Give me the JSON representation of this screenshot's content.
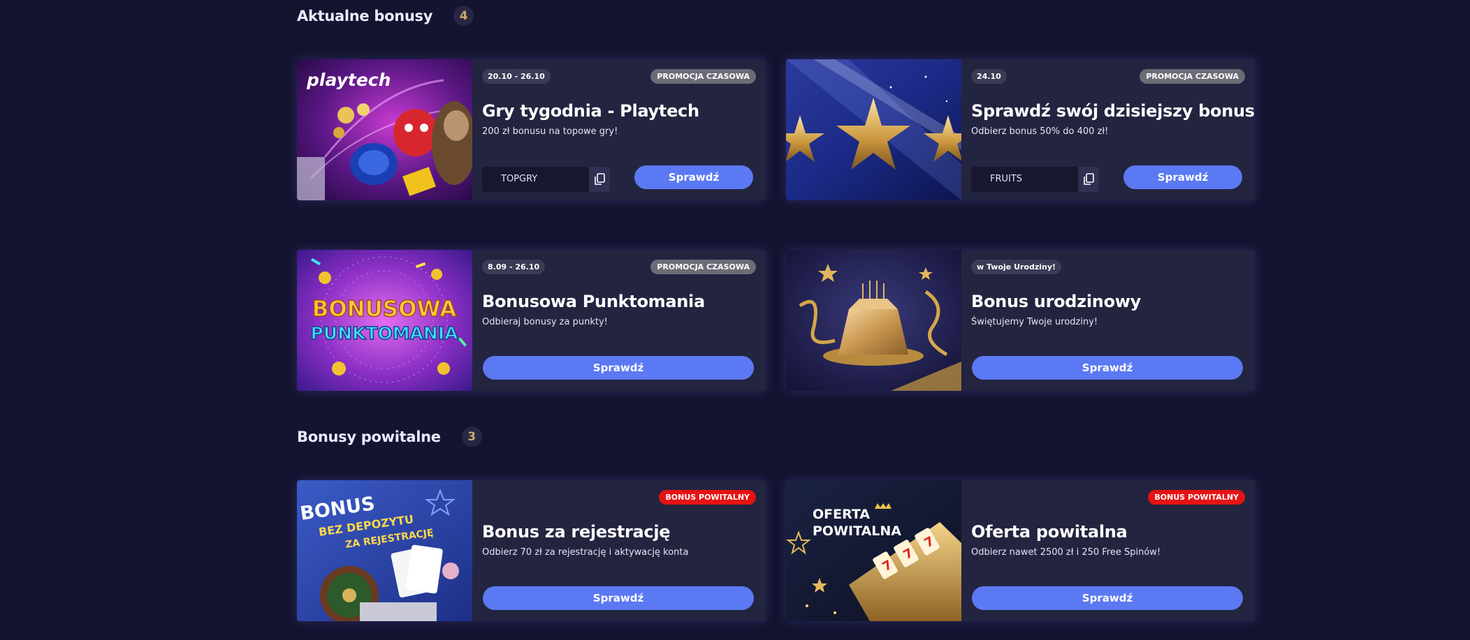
{
  "sections": {
    "current": {
      "title": "Aktualne bonusy",
      "count": "4"
    },
    "welcome": {
      "title": "Bonusy powitalne",
      "count": "3"
    }
  },
  "cards": [
    {
      "date": "20.10 - 26.10",
      "badge": "PROMOCJA CZASOWA",
      "title": "Gry tygodnia - Playtech",
      "desc": "200 zł bonusu na topowe gry!",
      "code": "TOPGRY",
      "button": "Sprawdź",
      "image_text": "playtech"
    },
    {
      "date": "24.10",
      "badge": "PROMOCJA CZASOWA",
      "title": "Sprawdź swój dzisiejszy bonus",
      "desc": "Odbierz bonus 50% do 400 zł!",
      "code": "FRUITS",
      "button": "Sprawdź"
    },
    {
      "date": "8.09 - 26.10",
      "badge": "PROMOCJA CZASOWA",
      "title": "Bonusowa Punktomania",
      "desc": "Odbieraj bonusy za punkty!",
      "button": "Sprawdź",
      "image_text_1": "BONUSOWA",
      "image_text_2": "PUNKTOMANIA"
    },
    {
      "date": "w Twoje Urodziny!",
      "title": "Bonus urodzinowy",
      "desc": "Świętujemy Twoje urodziny!",
      "button": "Sprawdź"
    },
    {
      "badge": "BONUS POWITALNY",
      "title": "Bonus za rejestrację",
      "desc": "Odbierz 70 zł za rejestrację i aktywację konta",
      "button": "Sprawdź",
      "image_text_1": "BONUS",
      "image_text_2": "BEZ DEPOZYTU",
      "image_text_3": "ZA REJESTRACJĘ"
    },
    {
      "badge": "BONUS POWITALNY",
      "title": "Oferta powitalna",
      "desc": "Odbierz nawet 2500 zł i 250 Free Spinów!",
      "button": "Sprawdź",
      "image_text_1": "OFERTA",
      "image_text_2": "POWITALNA"
    }
  ],
  "colors": {
    "background": "#141330",
    "card": "#23243f",
    "accent_button": "#5b79f2",
    "promo_badge": "#6c6c77",
    "welcome_badge": "#e51313",
    "count_text": "#c8a969"
  },
  "icons": {
    "copy": "copy-icon"
  }
}
